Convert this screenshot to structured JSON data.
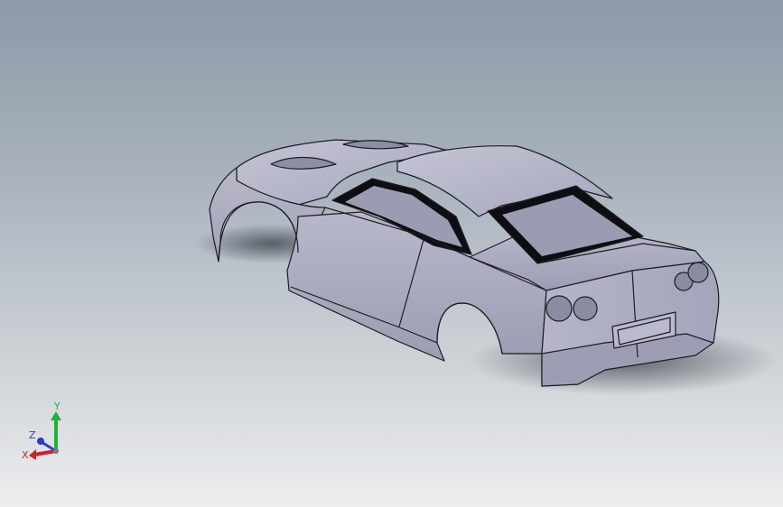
{
  "viewport": {
    "model_name": "car-body",
    "background_top": "#8d99a8",
    "background_bottom": "#eceeef",
    "body_color": "#a9aabd",
    "glass_color": "#8f91a8",
    "trim_color": "#111111"
  },
  "triad": {
    "x_label": "X",
    "y_label": "Y",
    "z_label": "Z",
    "x_color": "#d0202a",
    "y_color": "#22b035",
    "z_color": "#2a3ad0"
  }
}
